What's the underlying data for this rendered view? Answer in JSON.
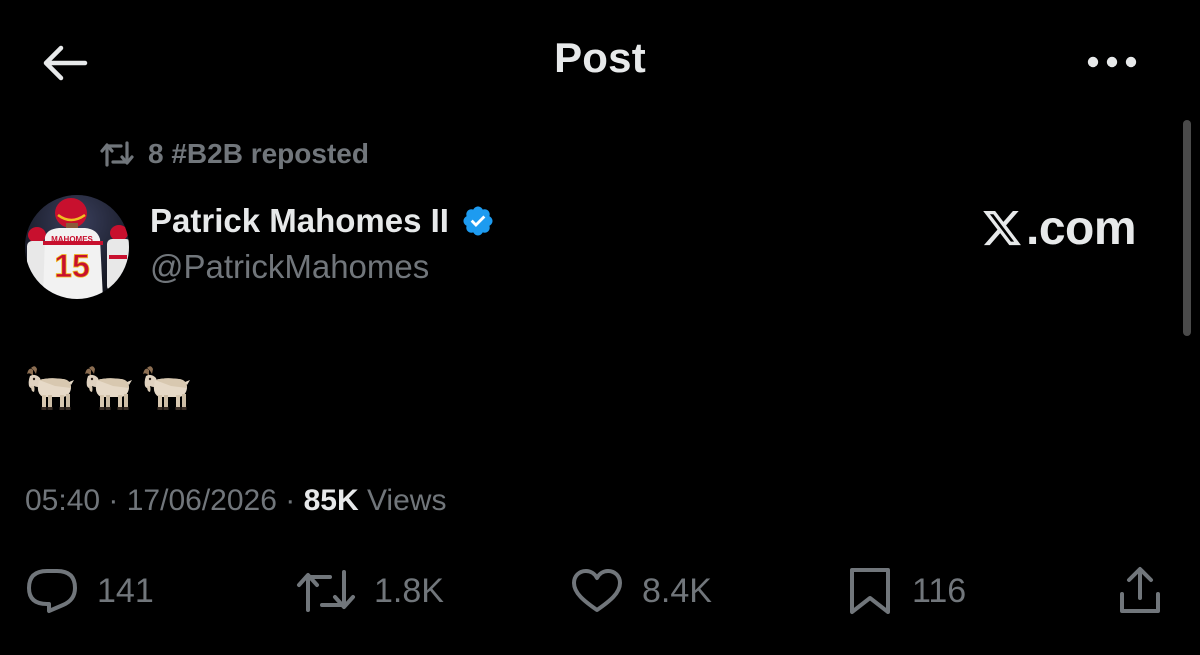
{
  "header": {
    "title": "Post"
  },
  "repost_context": {
    "text": "8 #B2B reposted"
  },
  "author": {
    "display_name": "Patrick Mahomes II",
    "handle": "@PatrickMahomes",
    "verified": true,
    "avatar_jersey_name": "MAHOMES",
    "avatar_jersey_number": "15"
  },
  "watermark": {
    "logo_letter": "𝕏",
    "text": ".com"
  },
  "tweet": {
    "content_icons": [
      "goat-emoji",
      "goat-emoji",
      "goat-emoji"
    ]
  },
  "meta": {
    "time": "05:40",
    "separator1": " · ",
    "date": "17/06/2026",
    "separator2": " · ",
    "views_count": "85K",
    "views_label": " Views"
  },
  "actions": {
    "replies": "141",
    "reposts": "1.8K",
    "likes": "8.4K",
    "bookmarks": "116"
  },
  "colors": {
    "background": "#000000",
    "text_primary": "#e7e9ea",
    "text_secondary": "#71767b",
    "verified_blue": "#1d9bf0"
  }
}
